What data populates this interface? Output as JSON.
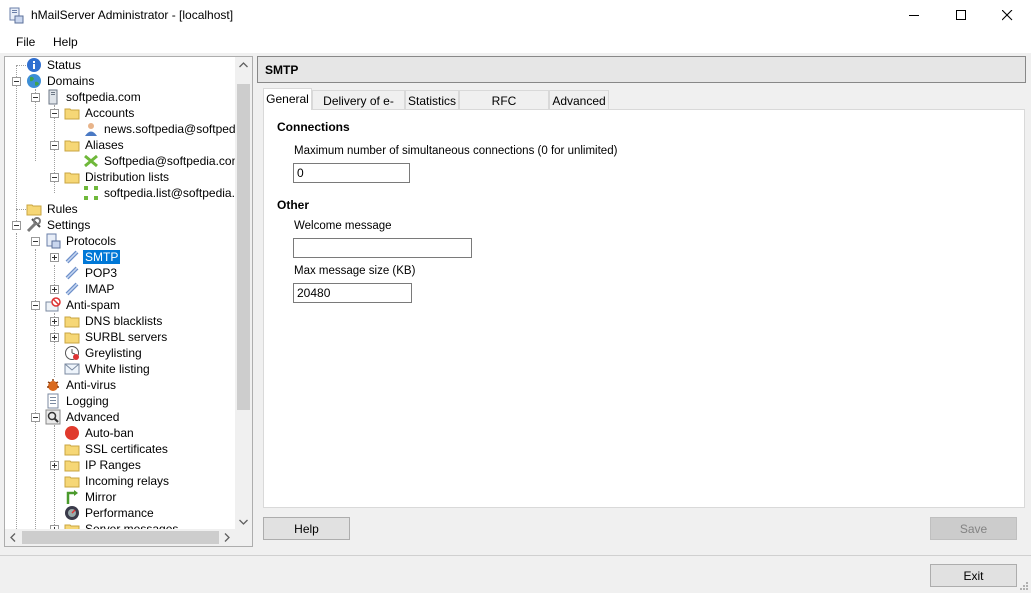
{
  "window": {
    "title": "hMailServer Administrator - [localhost]"
  },
  "menu": {
    "file": "File",
    "help": "Help"
  },
  "tree": {
    "status": "Status",
    "domains": "Domains",
    "domain": "softpedia.com",
    "accounts": "Accounts",
    "account_item": "news.softpedia@softpedia.com",
    "aliases": "Aliases",
    "alias_item": "Softpedia@softpedia.com",
    "distribution_lists": "Distribution lists",
    "dist_item": "softpedia.list@softpedia.com",
    "rules": "Rules",
    "settings": "Settings",
    "protocols": "Protocols",
    "smtp": "SMTP",
    "pop3": "POP3",
    "imap": "IMAP",
    "anti_spam": "Anti-spam",
    "dns_blacklists": "DNS blacklists",
    "surbl_servers": "SURBL servers",
    "greylisting": "Greylisting",
    "white_listing": "White listing",
    "anti_virus": "Anti-virus",
    "logging": "Logging",
    "advanced": "Advanced",
    "auto_ban": "Auto-ban",
    "ssl_certificates": "SSL certificates",
    "ip_ranges": "IP Ranges",
    "incoming_relays": "Incoming relays",
    "mirror": "Mirror",
    "performance": "Performance",
    "server_messages": "Server messages"
  },
  "panel": {
    "title": "SMTP",
    "tabs": [
      "General",
      "Delivery of e-mail",
      "Statistics",
      "RFC compliance",
      "Advanced"
    ],
    "active_tab": "General",
    "connections_heading": "Connections",
    "max_connections_label": "Maximum number of simultaneous connections (0 for unlimited)",
    "max_connections_value": "0",
    "other_heading": "Other",
    "welcome_message_label": "Welcome message",
    "welcome_message_value": "",
    "max_message_size_label": "Max message size (KB)",
    "max_message_size_value": "20480"
  },
  "buttons": {
    "help": "Help",
    "save": "Save",
    "exit": "Exit"
  },
  "colors": {
    "selection": "#0078d7",
    "folder": "#f6d776"
  }
}
